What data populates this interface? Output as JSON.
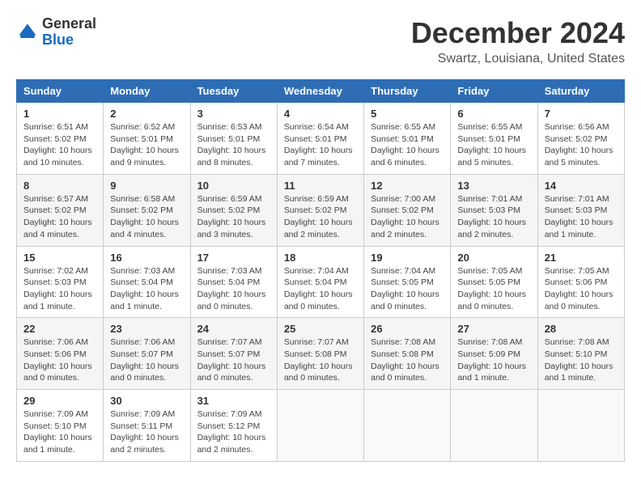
{
  "logo": {
    "general": "General",
    "blue": "Blue"
  },
  "title": "December 2024",
  "location": "Swartz, Louisiana, United States",
  "days_of_week": [
    "Sunday",
    "Monday",
    "Tuesday",
    "Wednesday",
    "Thursday",
    "Friday",
    "Saturday"
  ],
  "weeks": [
    [
      {
        "day": "1",
        "info": "Sunrise: 6:51 AM\nSunset: 5:02 PM\nDaylight: 10 hours and 10 minutes."
      },
      {
        "day": "2",
        "info": "Sunrise: 6:52 AM\nSunset: 5:01 PM\nDaylight: 10 hours and 9 minutes."
      },
      {
        "day": "3",
        "info": "Sunrise: 6:53 AM\nSunset: 5:01 PM\nDaylight: 10 hours and 8 minutes."
      },
      {
        "day": "4",
        "info": "Sunrise: 6:54 AM\nSunset: 5:01 PM\nDaylight: 10 hours and 7 minutes."
      },
      {
        "day": "5",
        "info": "Sunrise: 6:55 AM\nSunset: 5:01 PM\nDaylight: 10 hours and 6 minutes."
      },
      {
        "day": "6",
        "info": "Sunrise: 6:55 AM\nSunset: 5:01 PM\nDaylight: 10 hours and 5 minutes."
      },
      {
        "day": "7",
        "info": "Sunrise: 6:56 AM\nSunset: 5:02 PM\nDaylight: 10 hours and 5 minutes."
      }
    ],
    [
      {
        "day": "8",
        "info": "Sunrise: 6:57 AM\nSunset: 5:02 PM\nDaylight: 10 hours and 4 minutes."
      },
      {
        "day": "9",
        "info": "Sunrise: 6:58 AM\nSunset: 5:02 PM\nDaylight: 10 hours and 4 minutes."
      },
      {
        "day": "10",
        "info": "Sunrise: 6:59 AM\nSunset: 5:02 PM\nDaylight: 10 hours and 3 minutes."
      },
      {
        "day": "11",
        "info": "Sunrise: 6:59 AM\nSunset: 5:02 PM\nDaylight: 10 hours and 2 minutes."
      },
      {
        "day": "12",
        "info": "Sunrise: 7:00 AM\nSunset: 5:02 PM\nDaylight: 10 hours and 2 minutes."
      },
      {
        "day": "13",
        "info": "Sunrise: 7:01 AM\nSunset: 5:03 PM\nDaylight: 10 hours and 2 minutes."
      },
      {
        "day": "14",
        "info": "Sunrise: 7:01 AM\nSunset: 5:03 PM\nDaylight: 10 hours and 1 minute."
      }
    ],
    [
      {
        "day": "15",
        "info": "Sunrise: 7:02 AM\nSunset: 5:03 PM\nDaylight: 10 hours and 1 minute."
      },
      {
        "day": "16",
        "info": "Sunrise: 7:03 AM\nSunset: 5:04 PM\nDaylight: 10 hours and 1 minute."
      },
      {
        "day": "17",
        "info": "Sunrise: 7:03 AM\nSunset: 5:04 PM\nDaylight: 10 hours and 0 minutes."
      },
      {
        "day": "18",
        "info": "Sunrise: 7:04 AM\nSunset: 5:04 PM\nDaylight: 10 hours and 0 minutes."
      },
      {
        "day": "19",
        "info": "Sunrise: 7:04 AM\nSunset: 5:05 PM\nDaylight: 10 hours and 0 minutes."
      },
      {
        "day": "20",
        "info": "Sunrise: 7:05 AM\nSunset: 5:05 PM\nDaylight: 10 hours and 0 minutes."
      },
      {
        "day": "21",
        "info": "Sunrise: 7:05 AM\nSunset: 5:06 PM\nDaylight: 10 hours and 0 minutes."
      }
    ],
    [
      {
        "day": "22",
        "info": "Sunrise: 7:06 AM\nSunset: 5:06 PM\nDaylight: 10 hours and 0 minutes."
      },
      {
        "day": "23",
        "info": "Sunrise: 7:06 AM\nSunset: 5:07 PM\nDaylight: 10 hours and 0 minutes."
      },
      {
        "day": "24",
        "info": "Sunrise: 7:07 AM\nSunset: 5:07 PM\nDaylight: 10 hours and 0 minutes."
      },
      {
        "day": "25",
        "info": "Sunrise: 7:07 AM\nSunset: 5:08 PM\nDaylight: 10 hours and 0 minutes."
      },
      {
        "day": "26",
        "info": "Sunrise: 7:08 AM\nSunset: 5:08 PM\nDaylight: 10 hours and 0 minutes."
      },
      {
        "day": "27",
        "info": "Sunrise: 7:08 AM\nSunset: 5:09 PM\nDaylight: 10 hours and 1 minute."
      },
      {
        "day": "28",
        "info": "Sunrise: 7:08 AM\nSunset: 5:10 PM\nDaylight: 10 hours and 1 minute."
      }
    ],
    [
      {
        "day": "29",
        "info": "Sunrise: 7:09 AM\nSunset: 5:10 PM\nDaylight: 10 hours and 1 minute."
      },
      {
        "day": "30",
        "info": "Sunrise: 7:09 AM\nSunset: 5:11 PM\nDaylight: 10 hours and 2 minutes."
      },
      {
        "day": "31",
        "info": "Sunrise: 7:09 AM\nSunset: 5:12 PM\nDaylight: 10 hours and 2 minutes."
      },
      {
        "day": "",
        "info": ""
      },
      {
        "day": "",
        "info": ""
      },
      {
        "day": "",
        "info": ""
      },
      {
        "day": "",
        "info": ""
      }
    ]
  ]
}
